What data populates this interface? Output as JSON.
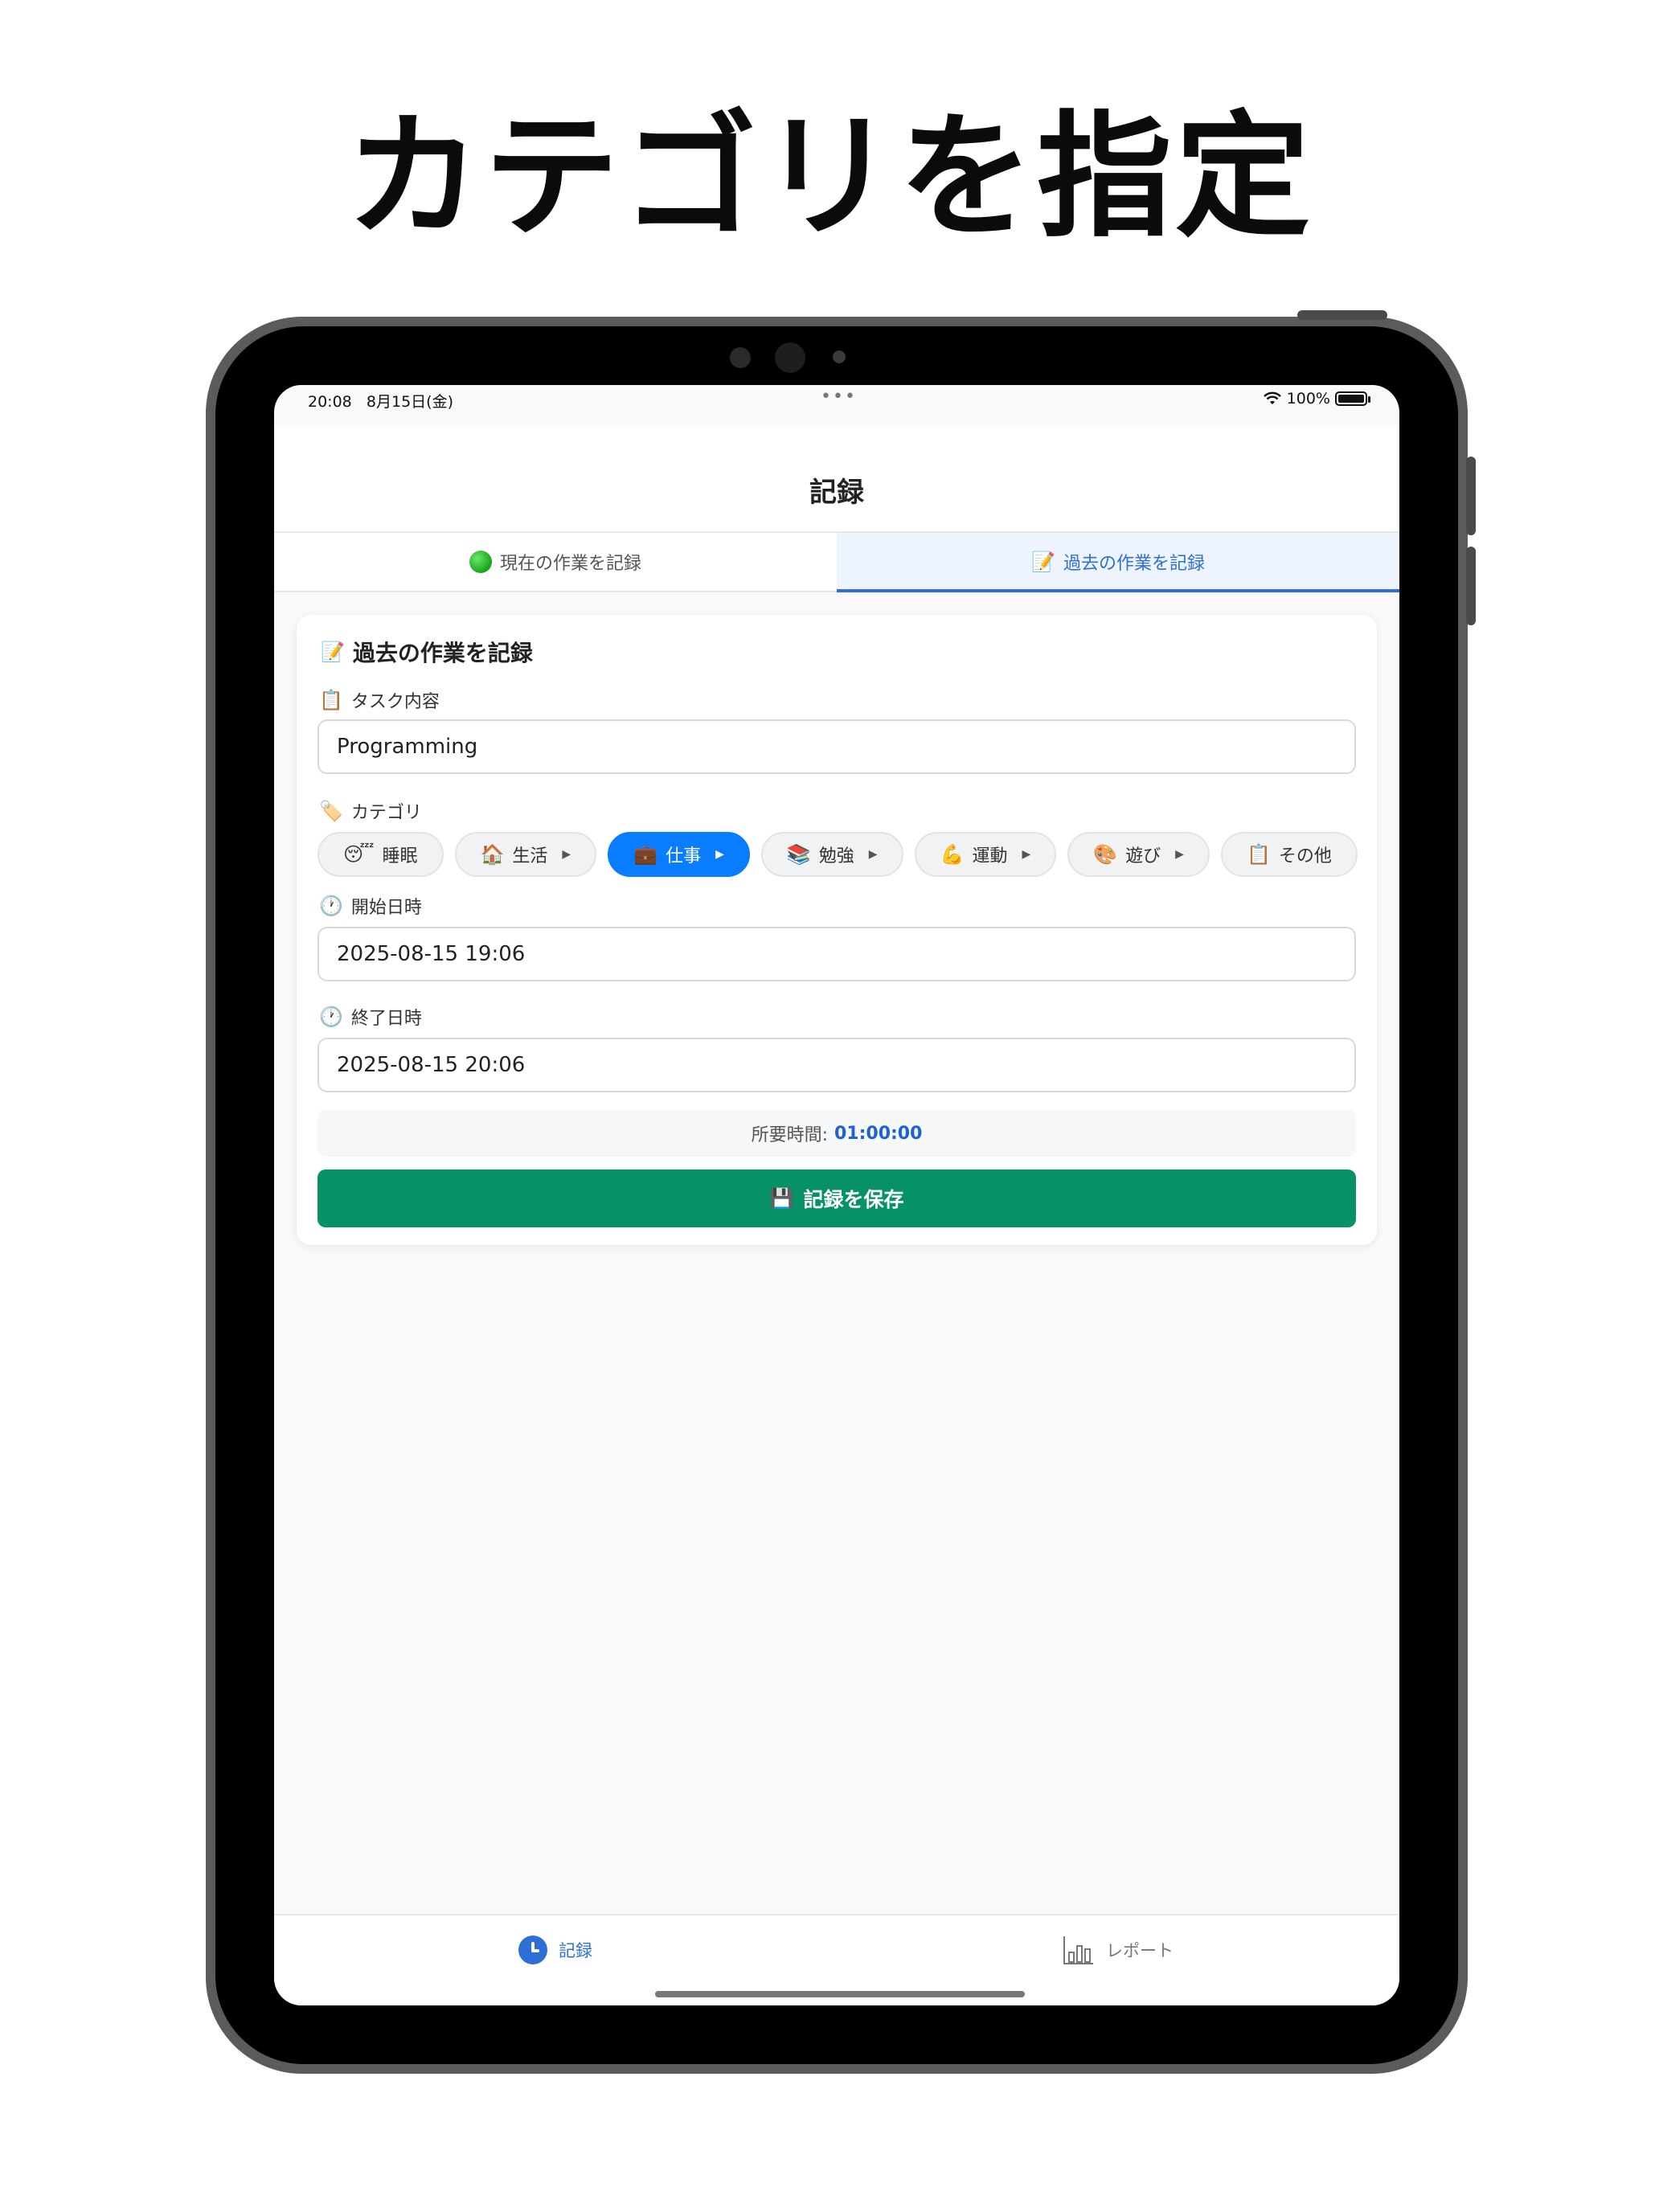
{
  "headline": "カテゴリを指定",
  "status": {
    "time": "20:08",
    "date": "8月15日(金)",
    "dots": "•••",
    "battery": "100%"
  },
  "header": {
    "title": "記録"
  },
  "tabs": [
    {
      "label": "現在の作業を記録"
    },
    {
      "label": "過去の作業を記録"
    }
  ],
  "form": {
    "title": "過去の作業を記録",
    "task_label": "タスク内容",
    "task_value": "Programming",
    "category_label": "カテゴリ",
    "categories": [
      {
        "emoji": "😴",
        "label": "睡眠",
        "arrow": ""
      },
      {
        "emoji": "🏠",
        "label": "生活",
        "arrow": "▶"
      },
      {
        "emoji": "💼",
        "label": "仕事",
        "arrow": "▶"
      },
      {
        "emoji": "📚",
        "label": "勉強",
        "arrow": "▶"
      },
      {
        "emoji": "💪",
        "label": "運動",
        "arrow": "▶"
      },
      {
        "emoji": "🎨",
        "label": "遊び",
        "arrow": "▶"
      },
      {
        "emoji": "📋",
        "label": "その他",
        "arrow": ""
      }
    ],
    "selected_category": "仕事",
    "start_label": "開始日時",
    "start_value": "2025-08-15 19:06",
    "end_label": "終了日時",
    "end_value": "2025-08-15 20:06",
    "duration_label": "所要時間:",
    "duration_value": "01:00:00",
    "save_label": "記録を保存"
  },
  "tabbar": {
    "record": "記録",
    "report": "レポート"
  },
  "icons": {
    "title_icon": "memo-icon",
    "task_icon": "clipboard-icon",
    "category_icon": "tag-icon",
    "start_icon": "clock-icon",
    "end_icon": "clock-icon",
    "save_icon": "floppy-disk-icon",
    "live_tab_icon": "green-circle-icon",
    "past_tab_icon": "memo-icon"
  },
  "colors": {
    "accent": "#2d6fd6",
    "selected_chip": "#0a7cff",
    "save_button": "#079167"
  }
}
